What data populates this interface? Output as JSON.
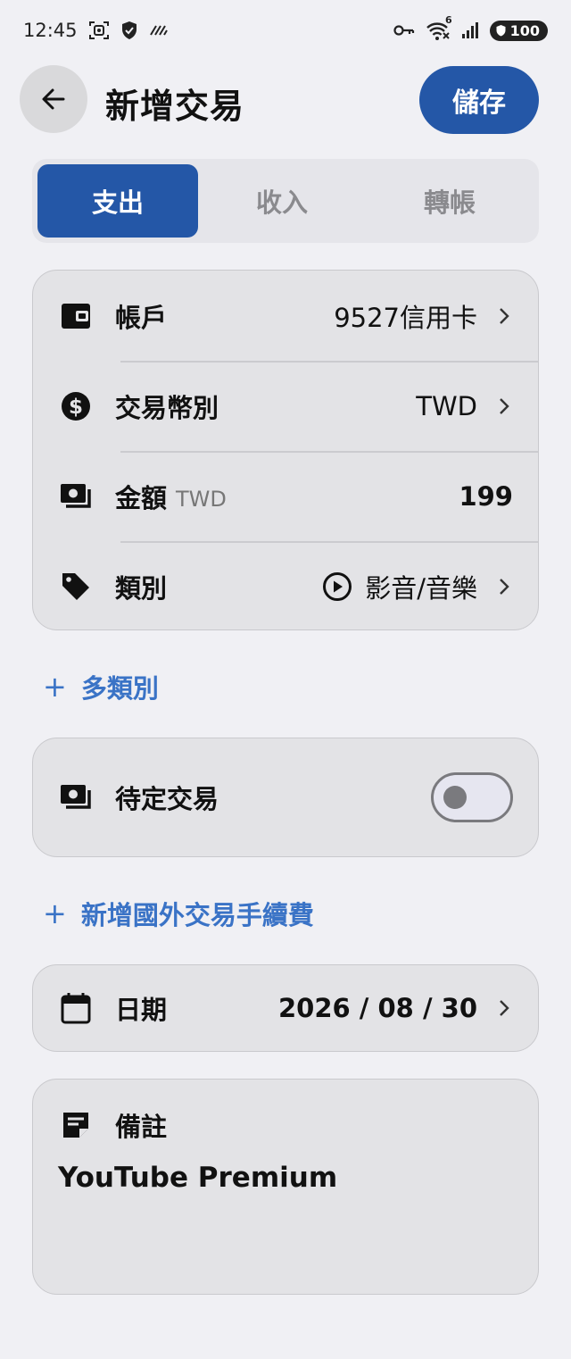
{
  "status_bar": {
    "time": "12:45",
    "battery": "100",
    "network_badge": "6",
    "icons": [
      "screenshot-icon",
      "shield-icon",
      "signal-slash-icon",
      "key-icon",
      "wifi-icon",
      "cell-signal-icon",
      "battery-icon"
    ]
  },
  "header": {
    "back_icon": "arrow-left-icon",
    "title": "新增交易",
    "save_label": "儲存"
  },
  "tabs": [
    {
      "label": "支出",
      "active": true
    },
    {
      "label": "收入",
      "active": false
    },
    {
      "label": "轉帳",
      "active": false
    }
  ],
  "details": {
    "account": {
      "icon": "wallet-icon",
      "label": "帳戶",
      "value": "9527信用卡"
    },
    "currency": {
      "icon": "dollar-circle-icon",
      "label": "交易幣別",
      "value": "TWD"
    },
    "amount": {
      "icon": "cash-icon",
      "label": "金額",
      "unit": "TWD",
      "value": "199"
    },
    "category": {
      "icon": "tag-icon",
      "label": "類別",
      "value_icon": "play-circle-icon",
      "value": "影音/音樂"
    }
  },
  "multi_category_link": {
    "plus": "+",
    "label": "多類別"
  },
  "pending": {
    "icon": "cash-icon",
    "label": "待定交易",
    "enabled": false
  },
  "fee_link": {
    "plus": "+",
    "label": "新增國外交易手續費"
  },
  "date": {
    "icon": "calendar-icon",
    "label": "日期",
    "value": "2026 / 08 / 30"
  },
  "note": {
    "icon": "note-icon",
    "label": "備註",
    "value": "YouTube Premium"
  },
  "colors": {
    "accent": "#2457a7",
    "link": "#3a73c6",
    "background": "#f0f0f4",
    "card": "#e3e3e6"
  }
}
